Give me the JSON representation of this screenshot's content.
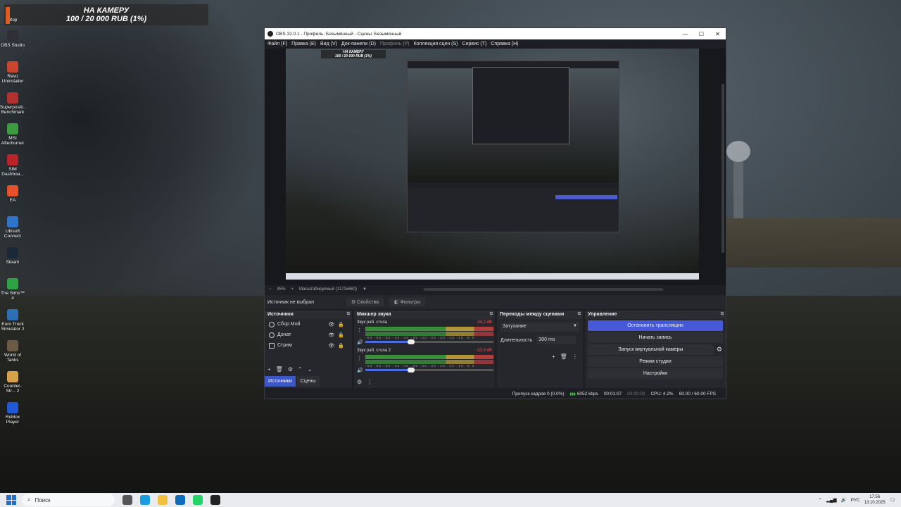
{
  "desktop": {
    "donation_banner": {
      "line1": "НА КАМЕРУ",
      "line2": "100 / 20 000 RUB (1%)",
      "corner_label": "Кор"
    },
    "icons": [
      {
        "label": "OBS Studio",
        "color": "#2f2f35"
      },
      {
        "label": "Revo Uninstaller",
        "color": "#c8452f"
      },
      {
        "label": "Superpositi... Benchmark",
        "color": "#b33030"
      },
      {
        "label": "MSI Afterburner",
        "color": "#3f9b3f"
      },
      {
        "label": "SIM Dashboa...",
        "color": "#b8242a"
      },
      {
        "label": "EA",
        "color": "#e6502a"
      },
      {
        "label": "Ubisoft Connect",
        "color": "#2f74c9"
      },
      {
        "label": "Steam",
        "color": "#1b2838"
      },
      {
        "label": "The Sims™ 4",
        "color": "#2fa343"
      },
      {
        "label": "Euro Truck Simulator 2",
        "color": "#2d6fb5"
      },
      {
        "label": "World of Tanks",
        "color": "#6b5a45"
      },
      {
        "label": "Counter-Str... 2",
        "color": "#d7a14a"
      },
      {
        "label": "Roblox Player",
        "color": "#2258d6"
      }
    ]
  },
  "obs": {
    "title": "OBS 32.0.1 - Профиль: Безымянный - Сцены: Безымянный",
    "window_controls": [
      "—",
      "☐",
      "✕"
    ],
    "menu": [
      "Файл (F)",
      "Правка (E)",
      "Вид (V)",
      "Док-панели (D)",
      "Профиль (P)",
      "Коллекция сцен (S)",
      "Сервис (T)",
      "Справка (H)"
    ],
    "zoom_bar": {
      "minus": "−",
      "zoom": "45%",
      "plus": "+",
      "mode": "Масштабируемый (1173x660)"
    },
    "preview_banner": {
      "line1": "НА КАМЕРУ",
      "line2": "100 / 20 000 RUB (1%)"
    },
    "source_bar": {
      "no_source": "Источник не выбран",
      "properties": "Свойства",
      "filters": "Фильтры"
    },
    "sources": {
      "title": "Источники",
      "items": [
        {
          "name": "Сбор Мой",
          "icon": "alert-icon"
        },
        {
          "name": "Донат",
          "icon": "alert-icon"
        },
        {
          "name": "Стрим",
          "icon": "display-capture-icon"
        }
      ],
      "tabs": [
        "Источники",
        "Сцены"
      ]
    },
    "mixer": {
      "title": "Микшер звука",
      "channels": [
        {
          "name": "Звук раб. стола",
          "db": "-34.2 dB"
        },
        {
          "name": "Звук раб. стола 2",
          "db": "-33.9 dB"
        }
      ],
      "scale": "-60 -55 -50 -45 -40 -35 -30 -25 -20 -15 -10 -5 0"
    },
    "transitions": {
      "title": "Переходы между сценами",
      "selected": "Затухание",
      "duration_label": "Длительность",
      "duration_value": "300 ms"
    },
    "controls": {
      "title": "Управление",
      "stop_stream": "Остановить трансляцию",
      "start_record": "Начать запись",
      "virtual_cam": "Запуск виртуальной камеры",
      "studio_mode": "Режим студии",
      "settings": "Настройки"
    },
    "status": {
      "dropped": "Пропуск кадров 0 (0.0%)",
      "kbps": "6052 kbps",
      "stream_time": "00:01:07",
      "record_time": "00:00:00",
      "cpu": "CPU: 4.2%",
      "fps": "60.00 / 60.00 FPS"
    },
    "accent": "#4659d8"
  },
  "taskbar": {
    "search_placeholder": "Поиск",
    "apps": [
      {
        "name": "task-view",
        "color": "#555"
      },
      {
        "name": "edge",
        "color": "#1b9de2"
      },
      {
        "name": "explorer",
        "color": "#f0c040"
      },
      {
        "name": "outlook",
        "color": "#0f6cbd"
      },
      {
        "name": "whatsapp",
        "color": "#25d366"
      },
      {
        "name": "obs",
        "color": "#222"
      }
    ],
    "lang": "РУС",
    "time": "17:56",
    "date": "13.10.2025"
  }
}
